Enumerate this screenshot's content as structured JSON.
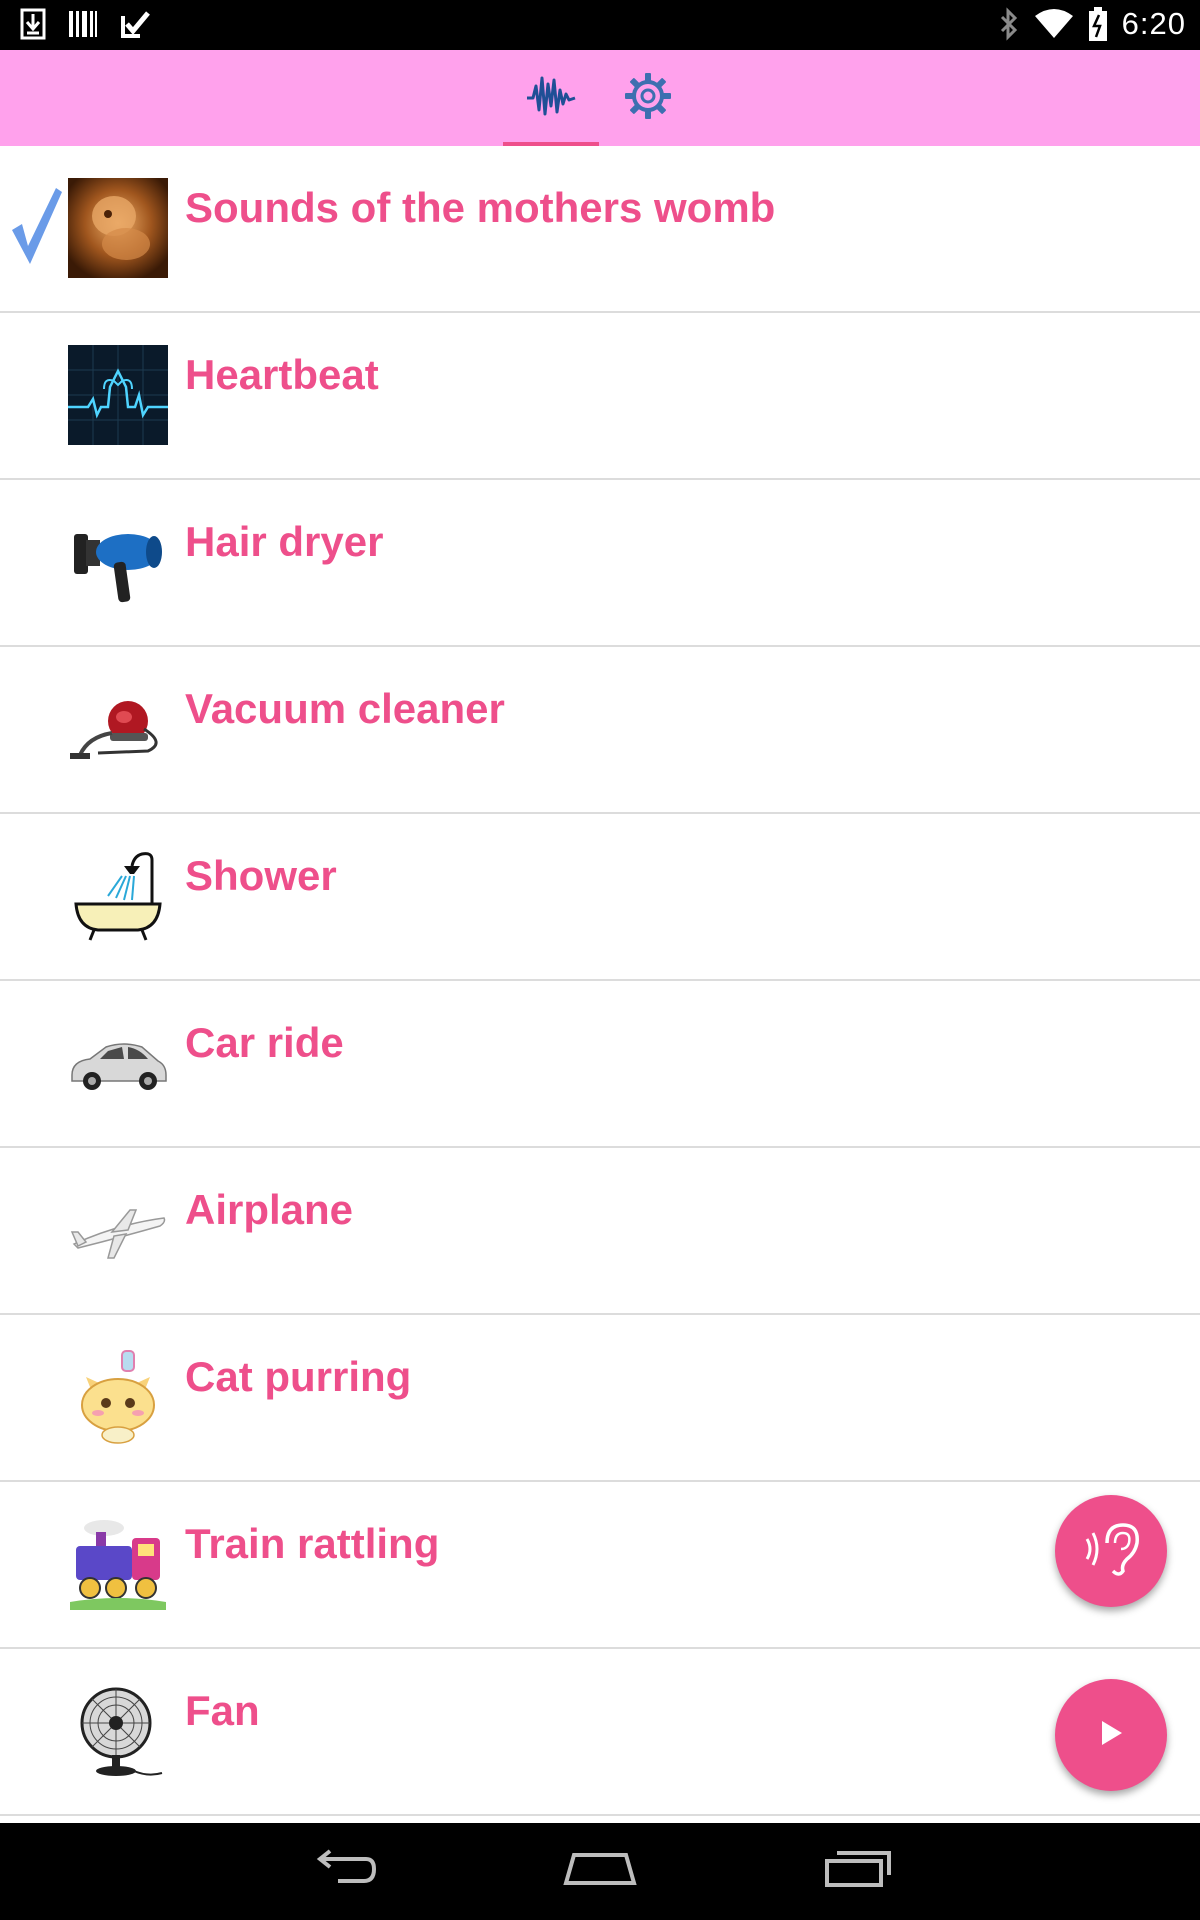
{
  "status_bar": {
    "time": "6:20",
    "left_icons": [
      "download-icon",
      "barcode-icon",
      "task-check-icon"
    ],
    "right_icons": [
      "bluetooth-icon",
      "wifi-icon",
      "battery-icon"
    ]
  },
  "tabs": [
    {
      "name": "sounds",
      "icon": "waveform-icon",
      "selected": true
    },
    {
      "name": "settings",
      "icon": "gear-icon",
      "selected": false
    }
  ],
  "sounds": [
    {
      "label": "Sounds of the mothers womb",
      "icon": "womb-ultrasound-icon",
      "selected": true
    },
    {
      "label": "Heartbeat",
      "icon": "heartbeat-monitor-icon",
      "selected": false
    },
    {
      "label": "Hair dryer",
      "icon": "hair-dryer-icon",
      "selected": false
    },
    {
      "label": "Vacuum cleaner",
      "icon": "vacuum-cleaner-icon",
      "selected": false
    },
    {
      "label": "Shower",
      "icon": "bathtub-shower-icon",
      "selected": false
    },
    {
      "label": "Car ride",
      "icon": "car-icon",
      "selected": false
    },
    {
      "label": "Airplane",
      "icon": "airplane-icon",
      "selected": false
    },
    {
      "label": "Cat purring",
      "icon": "kitten-icon",
      "selected": false
    },
    {
      "label": "Train rattling",
      "icon": "train-icon",
      "selected": false
    },
    {
      "label": "Fan",
      "icon": "fan-icon",
      "selected": false
    }
  ],
  "fabs": [
    {
      "name": "listen",
      "icon": "ear-sound-icon"
    },
    {
      "name": "play",
      "icon": "play-icon"
    }
  ],
  "nav_bar": [
    "back-icon",
    "home-icon",
    "recent-apps-icon"
  ],
  "colors": {
    "accent": "#ee4f8b",
    "header": "#ffa1ec",
    "tab_icon": "#1f4f96",
    "check": "#6a9be8",
    "divider": "#dcdcdc"
  }
}
